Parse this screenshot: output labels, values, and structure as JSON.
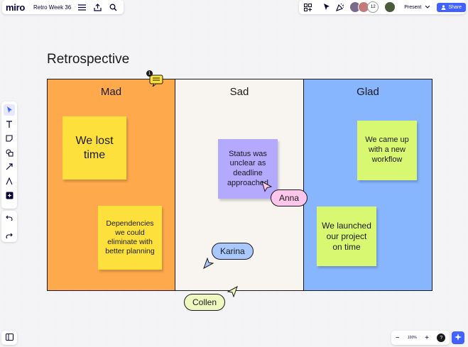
{
  "app": {
    "logo": "miro",
    "board_name": "Retro Week 36"
  },
  "topbar": {
    "collaborator_count": "12",
    "present_label": "Present",
    "share_label": "Share"
  },
  "zoom": {
    "level": "100%",
    "minus": "−",
    "plus": "+",
    "help": "?"
  },
  "board": {
    "title": "Retrospective",
    "columns": [
      {
        "label": "Mad",
        "color": "#ffa94d"
      },
      {
        "label": "Sad",
        "color": "#f8f5f0"
      },
      {
        "label": "Glad",
        "color": "#87b6ff"
      }
    ],
    "comment_badge": "1",
    "stickies": [
      {
        "text": "We lost time",
        "color": "#fde03b"
      },
      {
        "text": "Dependencies we could eliminate with better planning",
        "color": "#fde03b"
      },
      {
        "text": "Status was unclear as deadline approached",
        "color": "#b3a9ff"
      },
      {
        "text": "We came up with a new workflow",
        "color": "#d9f872"
      },
      {
        "text": "We launched our project on time",
        "color": "#d9f872"
      }
    ],
    "cursors": [
      {
        "name": "Anna",
        "color": "#ffc6ec"
      },
      {
        "name": "Karina",
        "color": "#a8c8ff"
      },
      {
        "name": "Collen",
        "color": "#eef7c0"
      }
    ]
  },
  "icons": {
    "menu": "menu-icon",
    "export": "export-icon",
    "search": "search-icon",
    "apps": "apps-icon",
    "reactions": "reactions-icon",
    "celebrate": "celebrate-icon",
    "select": "select-tool-icon",
    "text": "text-tool-icon",
    "sticky": "sticky-note-icon",
    "shapes": "shapes-icon",
    "line": "line-tool-icon",
    "pen": "pen-icon",
    "add": "add-icon",
    "undo": "undo-icon",
    "redo": "redo-icon",
    "panel": "panel-toggle-icon",
    "assist": "ai-assist-icon"
  }
}
